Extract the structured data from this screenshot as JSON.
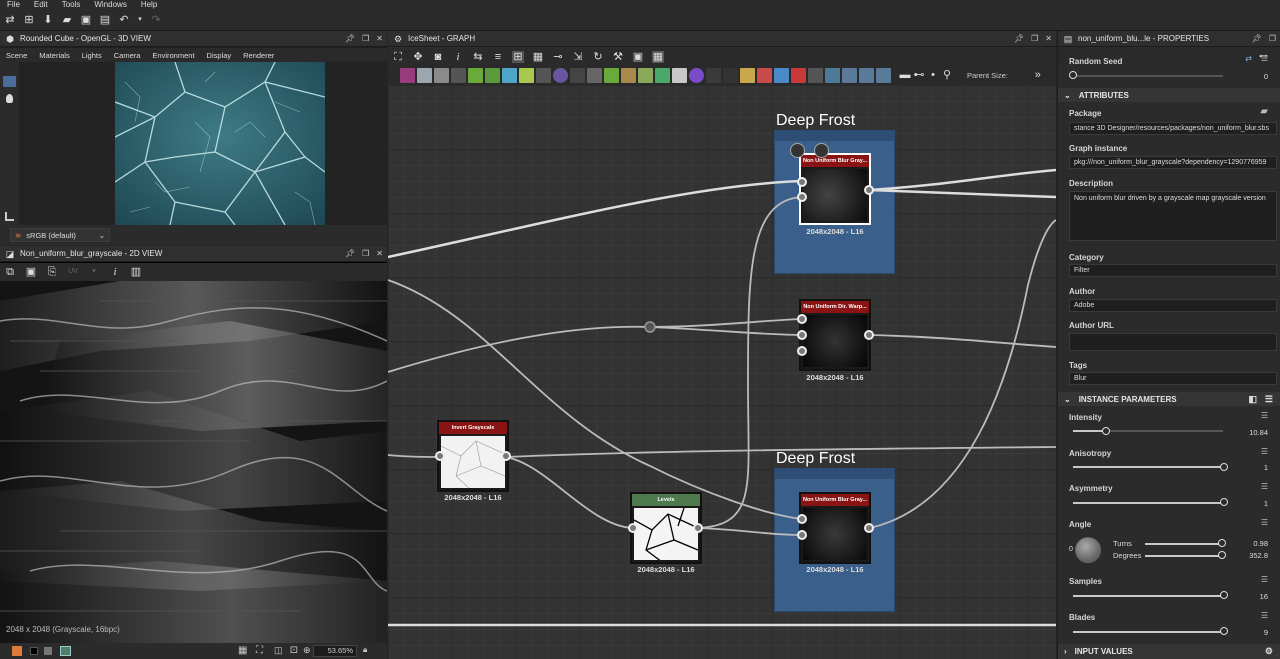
{
  "menu": [
    "File",
    "Edit",
    "Tools",
    "Windows",
    "Help"
  ],
  "view3d": {
    "title": "Rounded Cube - OpenGL - 3D VIEW",
    "menu": [
      "Scene",
      "Materials",
      "Lights",
      "Camera",
      "Environment",
      "Display",
      "Renderer"
    ],
    "colorspace": "sRGB (default)"
  },
  "view2d": {
    "title": "Non_uniform_blur_grayscale - 2D VIEW",
    "status": "2048 x 2048 (Grayscale, 16bpc)",
    "zoom": "53.65%"
  },
  "graph": {
    "title": "IceSheet - GRAPH",
    "parent_size_label": "Parent Size:",
    "frames": [
      {
        "title": "Deep Frost"
      },
      {
        "title": "Deep Frost"
      }
    ],
    "nodes": [
      {
        "name": "Non Uniform Blur Gray...",
        "size": "2048x2048 - L16",
        "color": "#8a1414"
      },
      {
        "name": "Non Uniform Dir. Warp...",
        "size": "2048x2048 - L16",
        "color": "#8a1414"
      },
      {
        "name": "Invert Grayscale",
        "size": "2048x2048 - L16",
        "color": "#8a1414"
      },
      {
        "name": "Levels",
        "size": "2048x2048 - L16",
        "color": "#4e7a4e"
      },
      {
        "name": "Non Uniform Blur Gray...",
        "size": "2048x2048 - L16",
        "color": "#8a1414"
      }
    ]
  },
  "props": {
    "title": "non_uniform_blu...le - PROPERTIES",
    "random_seed": {
      "label": "Random Seed",
      "value": "0"
    },
    "attributes": {
      "section": "ATTRIBUTES",
      "package_label": "Package",
      "package": "stance 3D Designer/resources/packages/non_uniform_blur.sbs",
      "graph_instance_label": "Graph instance",
      "graph_instance": "pkg:///non_uniform_blur_grayscale?dependency=1290776959",
      "description_label": "Description",
      "description": "Non uniform blur driven by a grayscale map grayscale version",
      "category_label": "Category",
      "category": "Filter",
      "author_label": "Author",
      "author": "Adobe",
      "author_url_label": "Author URL",
      "author_url": "",
      "tags_label": "Tags",
      "tags": "Blur"
    },
    "instance": {
      "section": "INSTANCE PARAMETERS",
      "intensity": {
        "label": "Intensity",
        "value": "10.84",
        "fraction": 0.22
      },
      "anisotropy": {
        "label": "Anisotropy",
        "value": "1",
        "fraction": 1.0
      },
      "asymmetry": {
        "label": "Asymmetry",
        "value": "1",
        "fraction": 1.0
      },
      "angle": {
        "label": "Angle",
        "turns_label": "Turns",
        "turns": "0.98",
        "degrees_label": "Degrees",
        "degrees": "352.8",
        "dial_zero": "0"
      },
      "samples": {
        "label": "Samples",
        "value": "16",
        "fraction": 1.0
      },
      "blades": {
        "label": "Blades",
        "value": "9",
        "fraction": 1.0
      }
    },
    "input_values": "INPUT VALUES"
  }
}
